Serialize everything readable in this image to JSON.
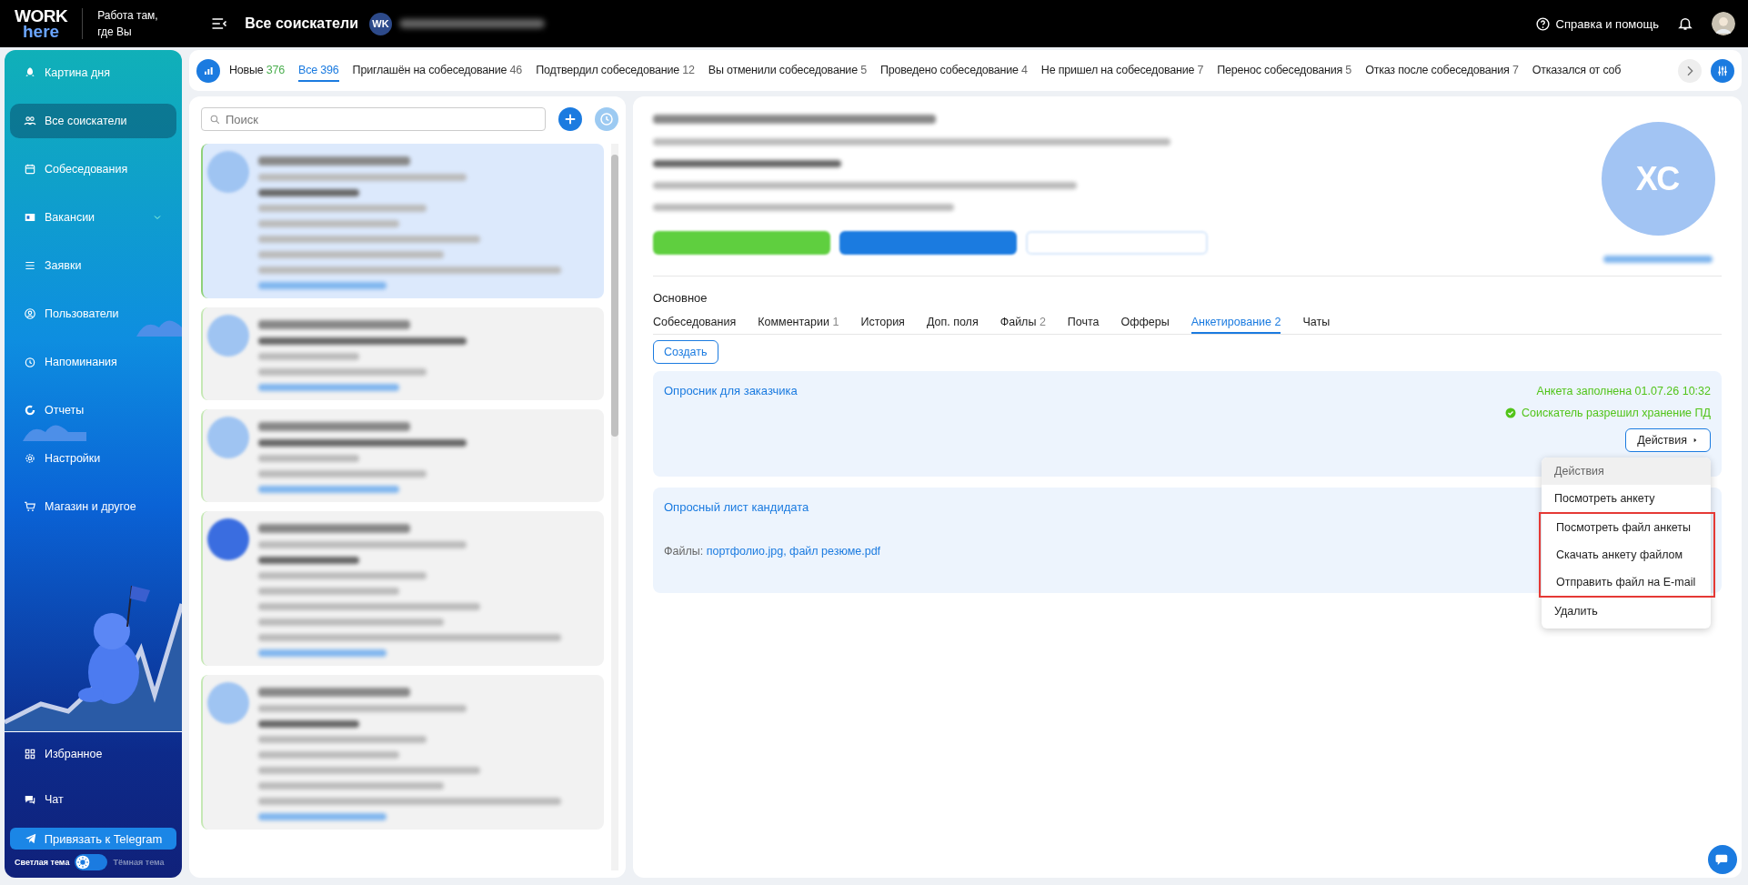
{
  "header": {
    "logo_top": "WORK",
    "logo_bottom": "here",
    "slogan": "Работа там, где Вы",
    "page_title": "Все соискатели",
    "company_badge": "WK",
    "help": "Справка и помощь"
  },
  "sidebar": {
    "items": [
      {
        "label": "Картина дня",
        "selected": false,
        "expandable": false
      },
      {
        "label": "Все соискатели",
        "selected": true,
        "expandable": false
      },
      {
        "label": "Собеседования",
        "selected": false,
        "expandable": false
      },
      {
        "label": "Вакансии",
        "selected": false,
        "expandable": true
      },
      {
        "label": "Заявки",
        "selected": false,
        "expandable": false
      },
      {
        "label": "Пользователи",
        "selected": false,
        "expandable": false
      },
      {
        "label": "Напоминания",
        "selected": false,
        "expandable": false
      },
      {
        "label": "Отчеты",
        "selected": false,
        "expandable": false
      },
      {
        "label": "Настройки",
        "selected": false,
        "expandable": false
      },
      {
        "label": "Магазин и другое",
        "selected": false,
        "expandable": false
      }
    ],
    "bottom_items": [
      {
        "label": "Избранное",
        "selected": false
      },
      {
        "label": "Чат",
        "selected": false
      }
    ],
    "telegram_button": "Привязать к Telegram",
    "theme": {
      "light_label": "Светлая тема",
      "dark_label": "Тёмная тема",
      "dark": false
    }
  },
  "status_tabs": [
    {
      "label": "Новые",
      "count": "376",
      "kind": "new",
      "selected": false
    },
    {
      "label": "Все",
      "count": "396",
      "kind": "status",
      "selected": true
    },
    {
      "label": "Приглашён на собеседование",
      "count": "46",
      "kind": "status",
      "selected": false
    },
    {
      "label": "Подтвердил собеседование",
      "count": "12",
      "kind": "status",
      "selected": false
    },
    {
      "label": "Вы отменили собеседование",
      "count": "5",
      "kind": "status",
      "selected": false
    },
    {
      "label": "Проведено собеседование",
      "count": "4",
      "kind": "status",
      "selected": false
    },
    {
      "label": "Не пришел на собеседование",
      "count": "7",
      "kind": "status",
      "selected": false
    },
    {
      "label": "Перенос собеседования",
      "count": "5",
      "kind": "status",
      "selected": false
    },
    {
      "label": "Отказ после собеседования",
      "count": "7",
      "kind": "status",
      "selected": false
    },
    {
      "label": "Отказался от соб",
      "selected": false
    }
  ],
  "search": {
    "placeholder": "Поиск"
  },
  "candidates": [
    {
      "selected": true,
      "kind": "full"
    },
    {
      "selected": false,
      "kind": "short"
    },
    {
      "selected": false,
      "kind": "short"
    },
    {
      "selected": false,
      "kind": "full",
      "photo": true
    },
    {
      "selected": false,
      "kind": "full"
    }
  ],
  "profile": {
    "avatar_initials": "ХС",
    "section_title": "Основное",
    "tabs": [
      {
        "label": "Собеседования",
        "selected": false
      },
      {
        "label": "Комментарии",
        "count": "1",
        "selected": false
      },
      {
        "label": "История",
        "selected": false
      },
      {
        "label": "Доп. поля",
        "selected": false
      },
      {
        "label": "Файлы",
        "count": "2",
        "selected": false
      },
      {
        "label": "Почта",
        "selected": false
      },
      {
        "label": "Офферы",
        "selected": false
      },
      {
        "label": "Анкетирование",
        "count": "2",
        "selected": true
      },
      {
        "label": "Чаты",
        "selected": false
      }
    ],
    "create_button": "Создать",
    "questionnaires": [
      {
        "title": "Опросник для заказчика",
        "status": "Анкета заполнена 01.07.26 10:32",
        "consent": "Соискатель разрешил хранение ПД",
        "actions_button": "Действия"
      },
      {
        "title": "Опросный лист кандидата",
        "files_label": "Файлы:",
        "files": "портфолио.jpg, файл резюме.pdf"
      }
    ],
    "menu": {
      "header": "Действия",
      "items": [
        {
          "label": "Посмотреть анкету",
          "highlighted": false
        },
        {
          "label": "Посмотреть файл анкеты",
          "highlighted": true
        },
        {
          "label": "Скачать анкету файлом",
          "highlighted": true
        },
        {
          "label": "Отправить файл на E-mail",
          "highlighted": true
        },
        {
          "label": "Удалить",
          "highlighted": false
        }
      ]
    }
  }
}
